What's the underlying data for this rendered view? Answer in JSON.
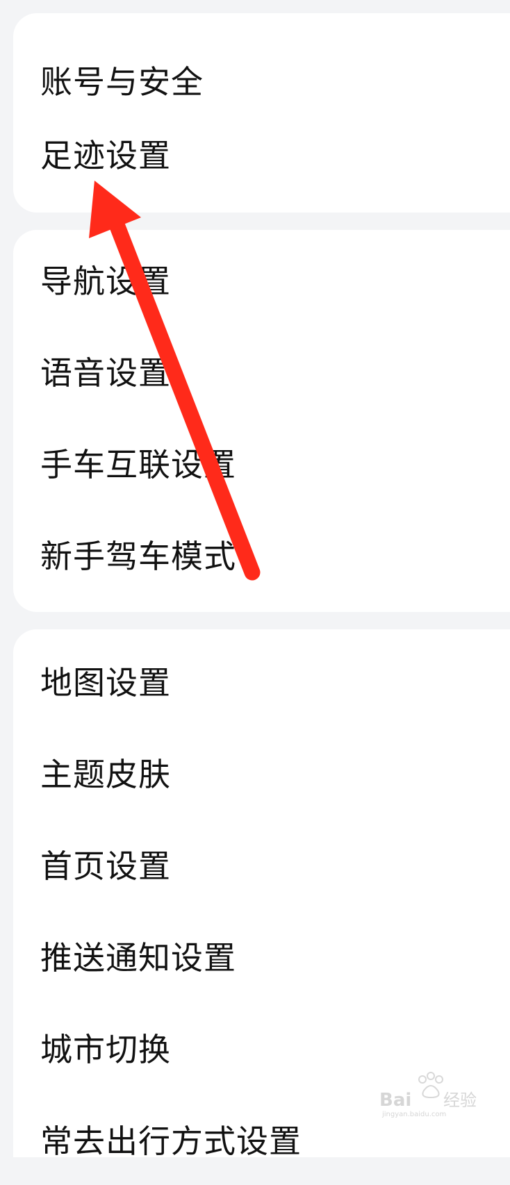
{
  "groups": [
    {
      "items": [
        {
          "label": "账号与安全"
        },
        {
          "label": "足迹设置"
        }
      ]
    },
    {
      "items": [
        {
          "label": "导航设置"
        },
        {
          "label": "语音设置"
        },
        {
          "label": "手车互联设置"
        },
        {
          "label": "新手驾车模式"
        }
      ]
    },
    {
      "items": [
        {
          "label": "地图设置"
        },
        {
          "label": "主题皮肤"
        },
        {
          "label": "首页设置"
        },
        {
          "label": "推送通知设置"
        },
        {
          "label": "城市切换"
        },
        {
          "label": "常去出行方式设置"
        }
      ]
    }
  ],
  "annotation": {
    "color": "#ff2a1a",
    "points_to": "足迹设置"
  },
  "watermark": {
    "text": "Baidu经验",
    "subtext": "jingyan.baidu.com"
  }
}
